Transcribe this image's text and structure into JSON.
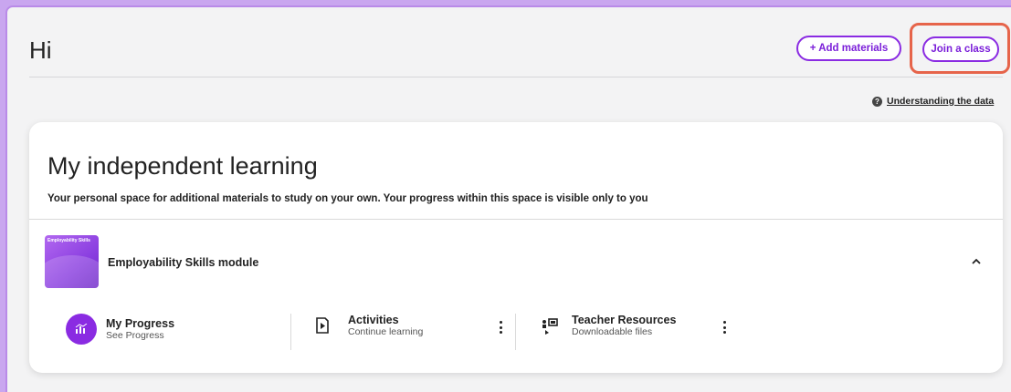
{
  "header": {
    "greeting": "Hi",
    "add_materials_label": "+ Add materials",
    "join_class_label": "Join a class",
    "understanding_label": "Understanding the data"
  },
  "card": {
    "title": "My independent learning",
    "subtitle": "Your personal space for additional materials to study on your own. Your progress within this space is visible only to you"
  },
  "module": {
    "thumb_label": "Employability Skills",
    "name": "Employability Skills module",
    "tiles": {
      "progress": {
        "title": "My Progress",
        "subtitle": "See Progress"
      },
      "activities": {
        "title": "Activities",
        "subtitle": "Continue learning"
      },
      "teacher": {
        "title": "Teacher Resources",
        "subtitle": "Downloadable files"
      }
    }
  },
  "colors": {
    "accent": "#8a2be2",
    "highlight": "#e6644a",
    "background": "#c9a6ef"
  }
}
